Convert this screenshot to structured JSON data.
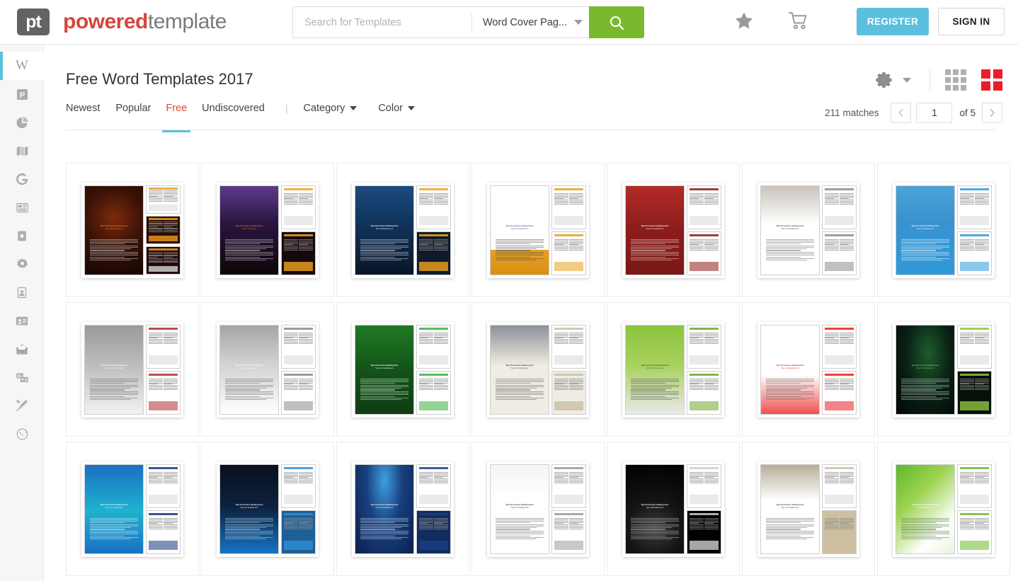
{
  "header": {
    "logo": {
      "mark_text": "pt",
      "word1": "powered",
      "word2": "template"
    },
    "search": {
      "placeholder": "Search for Templates",
      "value": "",
      "category_selected": "Word Cover Pag...",
      "button_icon": "search-icon"
    },
    "icons": [
      {
        "name": "favorites-star-icon",
        "glyph": "star"
      },
      {
        "name": "shopping-cart-icon",
        "glyph": "cart"
      }
    ],
    "register_label": "REGISTER",
    "signin_label": "SIGN IN",
    "colors": {
      "register_bg": "#5bc0de",
      "search_btn_bg": "#7ab92d",
      "brand_red": "#d6453d"
    }
  },
  "sidebar": {
    "items": [
      {
        "name": "sidebar-item-word",
        "icon": "word-w-icon",
        "active": true
      },
      {
        "name": "sidebar-item-powerpoint",
        "icon": "powerpoint-p-icon",
        "active": false
      },
      {
        "name": "sidebar-item-charts",
        "icon": "pie-chart-icon",
        "active": false
      },
      {
        "name": "sidebar-item-maps",
        "icon": "map-icon",
        "active": false
      },
      {
        "name": "sidebar-item-google",
        "icon": "google-g-icon",
        "active": false
      },
      {
        "name": "sidebar-item-newsletters",
        "icon": "newspaper-icon",
        "active": false
      },
      {
        "name": "sidebar-item-posters",
        "icon": "poster-icon",
        "active": false
      },
      {
        "name": "sidebar-item-logos",
        "icon": "logo-badge-icon",
        "active": false
      },
      {
        "name": "sidebar-item-portraits",
        "icon": "portrait-icon",
        "active": false
      },
      {
        "name": "sidebar-item-business-cards",
        "icon": "id-card-icon",
        "active": false
      },
      {
        "name": "sidebar-item-letterheads",
        "icon": "envelope-icon",
        "active": false
      },
      {
        "name": "sidebar-item-brochures",
        "icon": "cards-icon",
        "active": false
      },
      {
        "name": "sidebar-item-design-tools",
        "icon": "pen-brush-icon",
        "active": false
      },
      {
        "name": "sidebar-item-web",
        "icon": "globe-icon",
        "active": false
      }
    ]
  },
  "main": {
    "title": "Free Word Templates 2017",
    "filters": {
      "tabs": [
        {
          "label": "Newest",
          "active": false
        },
        {
          "label": "Popular",
          "active": false
        },
        {
          "label": "Free",
          "active": true
        },
        {
          "label": "Undiscovered",
          "active": false
        }
      ],
      "separator": "|",
      "dropdowns": [
        {
          "label": "Category"
        },
        {
          "label": "Color"
        }
      ]
    },
    "toolbar": {
      "settings_icon": "gear-icon",
      "settings_caret": "chevron-down-icon",
      "view_grid_small": "grid-view-small-icon",
      "view_grid_large": "grid-view-large-icon",
      "active_view": "grid-view-large-icon"
    },
    "pagination": {
      "matches_label": "211 matches",
      "prev_icon": "chevron-left-icon",
      "next_icon": "chevron-right-icon",
      "current_page": "1",
      "of_label": "of 5"
    }
  },
  "templates": [
    {
      "id": 1,
      "name": "halloween-pumpkin-dark",
      "heading": "Type Document Heading Here",
      "subheading": "Type subheading here",
      "cover_css": "radial-gradient(circle at 50% 36%, #7d2a0d 0%, #3a1206 45%, #140604 100%)",
      "accent": "#f09a1e",
      "cover_text": "#e8862b",
      "body_text": "#cfcfcf",
      "previews": 3,
      "preview_bgs": [
        "#ffffff",
        "#2a0e06",
        "#24090a"
      ]
    },
    {
      "id": 2,
      "name": "halloween-graveyard-purple",
      "heading": "Type Document Heading Here",
      "subheading": "Type subtitle here",
      "cover_css": "linear-gradient(180deg, #5b3b8a 0%, #2a1540 42%, #0c0608 100%)",
      "accent": "#f0a61e",
      "cover_text": "#e0742c",
      "body_text": "#c8c8c8",
      "previews": 2,
      "preview_bgs": [
        "#ffffff",
        "#17090b"
      ]
    },
    {
      "id": 3,
      "name": "halloween-pumpkins-blue-night",
      "heading": "Type Document Heading Here",
      "subheading": "Type subheading here",
      "cover_css": "linear-gradient(180deg, #1c4a7e 0%, #123a66 30%, #0a1526 100%)",
      "accent": "#f2a41c",
      "cover_text": "#ffffff",
      "body_text": "#c9d4de",
      "previews": 2,
      "preview_bgs": [
        "#ffffff",
        "#0e1b2c"
      ]
    },
    {
      "id": 4,
      "name": "book-education-orange",
      "heading": "Type Document Heading Here",
      "subheading": "Type sub heading here",
      "cover_css": "linear-gradient(180deg, #ffffff 0%, #ffffff 72%, #e8a020 72%, #d98f13 100%)",
      "accent": "#e8a020",
      "cover_text": "#4a4fa8",
      "body_text": "#555555",
      "previews": 2,
      "preview_bgs": [
        "#ffffff",
        "#ffffff"
      ]
    },
    {
      "id": 5,
      "name": "medical-ampoules-red",
      "heading": "Type Document Heading Here",
      "subheading": "Type sub heading here",
      "cover_css": "linear-gradient(180deg, #b22b26 0%, #8c1d1c 48%, #7a1816 100%)",
      "accent": "#8c1d1c",
      "cover_text": "#ffffff",
      "body_text": "#e8c9c9",
      "previews": 2,
      "preview_bgs": [
        "#ffffff",
        "#ffffff"
      ]
    },
    {
      "id": 6,
      "name": "hands-grayscale-white",
      "heading": "Type Document Heading Here",
      "subheading": "Type sub heading here",
      "cover_css": "linear-gradient(180deg, #c9c2bb 0%, #ffffff 42%, #ffffff 100%)",
      "accent": "#8d8d8d",
      "cover_text": "#444444",
      "body_text": "#777777",
      "previews": 2,
      "preview_bgs": [
        "#ffffff",
        "#ffffff"
      ]
    },
    {
      "id": 7,
      "name": "medical-surgery-blue",
      "heading": "Type Document Heading Here",
      "subheading": "Type sub heading here",
      "cover_css": "linear-gradient(180deg, #4ba3d8 0%, #3a92cf 38%, #2f9ada 100%)",
      "accent": "#2f9ada",
      "cover_text": "#ffffff",
      "body_text": "#eaf4fb",
      "previews": 2,
      "preview_bgs": [
        "#ffffff",
        "#ffffff"
      ]
    },
    {
      "id": 8,
      "name": "ironing-board-gray",
      "heading": "Type Document Heading Here",
      "subheading": "Type sub heading here",
      "cover_css": "linear-gradient(180deg, #9a9a9a 0%, #bdbdbd 45%, #f2f2f2 100%)",
      "accent": "#b03030",
      "cover_text": "#ffffff",
      "body_text": "#6f6f6f",
      "previews": 2,
      "preview_bgs": [
        "#ffffff",
        "#ffffff"
      ]
    },
    {
      "id": 9,
      "name": "flea-insect-gray",
      "heading": "Type Document Heading Here",
      "subheading": "Type sub heading here",
      "cover_css": "linear-gradient(180deg, #a5a5a5 0%, #cfcfcf 40%, #ffffff 100%)",
      "accent": "#8a8a8a",
      "cover_text": "#ffffff",
      "body_text": "#6f6f6f",
      "previews": 2,
      "preview_bgs": [
        "#ffffff",
        "#ffffff"
      ]
    },
    {
      "id": 10,
      "name": "bacteria-green-texture",
      "heading": "Type Document Heading Here",
      "subheading": "Type sub heading here",
      "cover_css": "linear-gradient(180deg, #1f7a24 0%, #14531a 50%, #0e3d14 100%)",
      "accent": "#3bb03c",
      "cover_text": "#ffffff",
      "body_text": "#c6e6c6",
      "previews": 2,
      "preview_bgs": [
        "#ffffff",
        "#ffffff"
      ]
    },
    {
      "id": 11,
      "name": "crosswalk-people-beige",
      "heading": "Type Document Heading Here",
      "subheading": "Type sub heading here",
      "cover_css": "linear-gradient(180deg, #8c9099 0%, #efece2 45%, #efece2 100%)",
      "accent": "#c8bfa8",
      "cover_text": "#3d3d3d",
      "body_text": "#6a6a6a",
      "previews": 2,
      "preview_bgs": [
        "#ffffff",
        "#efece2"
      ]
    },
    {
      "id": 12,
      "name": "railway-green-nature",
      "heading": "Type Document Heading Here",
      "subheading": "Type sub heading here",
      "cover_css": "linear-gradient(180deg, #8bc43f 0%, #a8d15c 44%, #e9e9e9 100%)",
      "accent": "#6fa82c",
      "cover_text": "#2c5c16",
      "body_text": "#5c5c5c",
      "previews": 2,
      "preview_bgs": [
        "#ffffff",
        "#ffffff"
      ]
    },
    {
      "id": 13,
      "name": "red-crowd-white",
      "heading": "Type Document Heading Here",
      "subheading": "Type sub heading here",
      "cover_css": "linear-gradient(180deg, #ffffff 0%, #ffffff 56%, #f05050 100%)",
      "accent": "#ed1c24",
      "cover_text": "#d6171e",
      "body_text": "#6f6f6f",
      "previews": 2,
      "preview_bgs": [
        "#ffffff",
        "#ffffff"
      ]
    },
    {
      "id": 14,
      "name": "green-waves-black",
      "heading": "Type Document Heading Here",
      "subheading": "Type sub heading here",
      "cover_css": "radial-gradient(ellipse at 55% 32%, #1d5c2c 0%, #0a2216 48%, #020604 100%)",
      "accent": "#8ec63f",
      "cover_text": "#8ec63f",
      "body_text": "#b9c9b9",
      "previews": 2,
      "preview_bgs": [
        "#ffffff",
        "#071009"
      ]
    },
    {
      "id": 15,
      "name": "happy-new-year-blue",
      "heading": "Type Document Heading Here",
      "subheading": "Type sub heading here",
      "cover_css": "linear-gradient(180deg, #1a6fc4 0%, #1fb3cf 52%, #1a6fc4 100%)",
      "accent": "#14367e",
      "cover_text": "#ffffff",
      "body_text": "#dbe9f7",
      "previews": 2,
      "preview_bgs": [
        "#ffffff",
        "#ffffff"
      ]
    },
    {
      "id": 16,
      "name": "tech-abstract-dark-blue",
      "heading": "Type Document Heading Here",
      "subheading": "Type sub heading here",
      "cover_css": "linear-gradient(180deg, #0a0f1c 0%, #0d2240 48%, #1474c4 100%)",
      "accent": "#2f8fd6",
      "cover_text": "#ffffff",
      "body_text": "#b9cde0",
      "previews": 2,
      "preview_bgs": [
        "#ffffff",
        "#1d5f96"
      ]
    },
    {
      "id": 17,
      "name": "blue-rays-navy",
      "heading": "Type Document Heading Here",
      "subheading": "Type sub heading here",
      "cover_css": "radial-gradient(ellipse at 50% 18%, #3f9fe0 0%, #18407f 44%, #0d1f4d 100%)",
      "accent": "#1b3f86",
      "cover_text": "#ffffff",
      "body_text": "#c3d3ea",
      "previews": 2,
      "preview_bgs": [
        "#ffffff",
        "#132c5e"
      ]
    },
    {
      "id": 18,
      "name": "line-art-sketch-white",
      "heading": "Type Document Heading Here",
      "subheading": "Type sub heading here",
      "cover_css": "linear-gradient(180deg, #f4f4f4 0%, #ffffff 38%, #ffffff 100%)",
      "accent": "#9b9b9b",
      "cover_text": "#333333",
      "body_text": "#707070",
      "previews": 2,
      "preview_bgs": [
        "#ffffff",
        "#ffffff"
      ]
    },
    {
      "id": 19,
      "name": "crystal-sphere-black",
      "heading": "Type Document Heading Here",
      "subheading": "Type subheading here",
      "cover_css": "radial-gradient(circle at 50% 72%, #3a3a3a 0%, #141414 40%, #000000 100%)",
      "accent": "#cfcfcf",
      "cover_text": "#ffffff",
      "body_text": "#b5b5b5",
      "previews": 2,
      "preview_bgs": [
        "#ffffff",
        "#000000"
      ]
    },
    {
      "id": 20,
      "name": "office-interior-beige",
      "heading": "Type Document Heading Here",
      "subheading": "Type sub heading here",
      "cover_css": "linear-gradient(180deg, #b8ad9a 0%, #ffffff 40%, #ffffff 100%)",
      "accent": "#cdbf9f",
      "cover_text": "#3d3d3d",
      "body_text": "#6f6f6f",
      "previews": 2,
      "preview_bgs": [
        "#ffffff",
        "#cdbf9f"
      ]
    },
    {
      "id": 21,
      "name": "green-gradient-soft",
      "heading": "Type Document Heading Here",
      "subheading": "Type sub heading here",
      "cover_css": "linear-gradient(135deg, #5fb82e 0%, #9bd34f 35%, #ffffff 75%, #e9f5dc 100%)",
      "accent": "#6cb92e",
      "cover_text": "#ffffff",
      "body_text": "#5f7a4f",
      "previews": 2,
      "preview_bgs": [
        "#ffffff",
        "#ffffff"
      ]
    }
  ]
}
